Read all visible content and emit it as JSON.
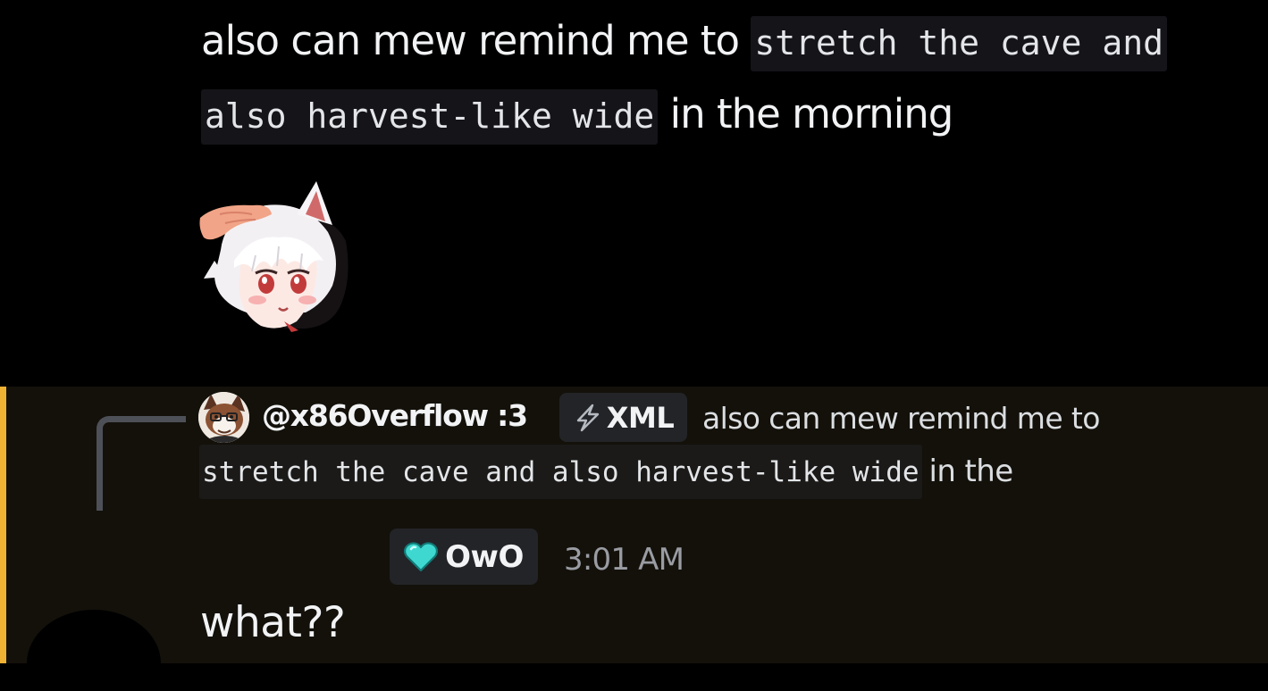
{
  "top_message": {
    "text_before": "also can mew remind me to",
    "code_line1": "stretch the cave",
    "code_line2": "and also harvest-like wide",
    "text_after": "in the morning"
  },
  "sticker": {
    "icon": "catgirl-headpat-sticker"
  },
  "reply_message": {
    "highlight_color": "#f0b232",
    "reply_preview": {
      "username": "@x86Overflow :3",
      "tag_icon": "lightning-icon",
      "tag_label": "XML",
      "text_line1": "also can mew remind me to",
      "code": "stretch the cave and also harvest-like wide",
      "text_after": "in the"
    },
    "role_icon": "cyan-heart-icon",
    "role_label": "OwO",
    "timestamp": "3:01 AM",
    "content": "what??"
  },
  "colors": {
    "background": "#000000",
    "mention_background": "#13110a",
    "mention_bar": "#f0b232",
    "heart": "#3ed8d0"
  }
}
